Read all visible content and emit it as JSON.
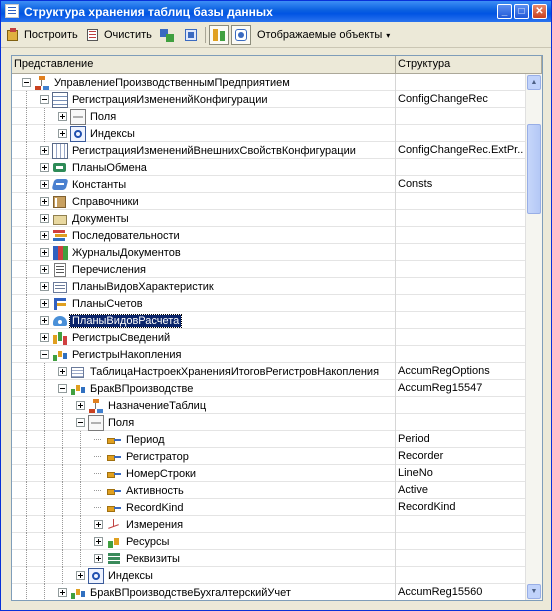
{
  "window": {
    "title": "Структура хранения таблиц базы данных"
  },
  "title_buttons": {
    "minimize": "_",
    "maximize": "□",
    "close": "✕"
  },
  "toolbar": {
    "build_label": "Построить",
    "clear_label": "Очистить",
    "objects_label": "Отображаемые объекты",
    "dropdown_arrow": "▾"
  },
  "columns": {
    "representation": "Представление",
    "structure": "Структура"
  },
  "tree": [
    {
      "label": "УправлениеПроизводственнымПредприятием",
      "structure": "",
      "depth": 0,
      "toggle": "minus",
      "icon": "tree-icon"
    },
    {
      "label": "РегистрацияИзмененийКонфигурации",
      "structure": "ConfigChangeRec",
      "depth": 1,
      "toggle": "minus",
      "icon": "grid-icon"
    },
    {
      "label": "Поля",
      "structure": "",
      "depth": 2,
      "toggle": "plus",
      "icon": "field-icon"
    },
    {
      "label": "Индексы",
      "structure": "",
      "depth": 2,
      "toggle": "plus",
      "icon": "index-icon"
    },
    {
      "label": "РегистрацияИзмененийВнешнихСвойствКонфигурации",
      "structure": "ConfigChangeRec.ExtPr...",
      "depth": 1,
      "toggle": "plus",
      "icon": "ext-grid-icon"
    },
    {
      "label": "ПланыОбмена",
      "structure": "",
      "depth": 1,
      "toggle": "plus",
      "icon": "exchange-plan-icon"
    },
    {
      "label": "Константы",
      "structure": "Consts",
      "depth": 1,
      "toggle": "plus",
      "icon": "constant-icon"
    },
    {
      "label": "Справочники",
      "structure": "",
      "depth": 1,
      "toggle": "plus",
      "icon": "catalog-icon"
    },
    {
      "label": "Документы",
      "structure": "",
      "depth": 1,
      "toggle": "plus",
      "icon": "document-icon"
    },
    {
      "label": "Последовательности",
      "structure": "",
      "depth": 1,
      "toggle": "plus",
      "icon": "sequence-icon"
    },
    {
      "label": "ЖурналыДокументов",
      "structure": "",
      "depth": 1,
      "toggle": "plus",
      "icon": "journal-icon"
    },
    {
      "label": "Перечисления",
      "structure": "",
      "depth": 1,
      "toggle": "plus",
      "icon": "enum-icon"
    },
    {
      "label": "ПланыВидовХарактеристик",
      "structure": "",
      "depth": 1,
      "toggle": "plus",
      "icon": "char-types-icon"
    },
    {
      "label": "ПланыСчетов",
      "structure": "",
      "depth": 1,
      "toggle": "plus",
      "icon": "accounts-icon"
    },
    {
      "label": "ПланыВидовРасчета",
      "structure": "",
      "depth": 1,
      "toggle": "plus",
      "icon": "calc-types-icon",
      "selected": true
    },
    {
      "label": "РегистрыСведений",
      "structure": "",
      "depth": 1,
      "toggle": "plus",
      "icon": "info-register-icon"
    },
    {
      "label": "РегистрыНакопления",
      "structure": "",
      "depth": 1,
      "toggle": "minus",
      "icon": "accum-register-icon"
    },
    {
      "label": "ТаблицаНастроекХраненияИтоговРегистровНакопления",
      "structure": "AccumRegOptions",
      "depth": 2,
      "toggle": "plus",
      "icon": "table-icon"
    },
    {
      "label": "БракВПроизводстве",
      "structure": "AccumReg15547",
      "depth": 2,
      "toggle": "minus",
      "icon": "accum-register-icon"
    },
    {
      "label": "НазначениеТаблиц",
      "structure": "",
      "depth": 3,
      "toggle": "plus",
      "icon": "tree-icon"
    },
    {
      "label": "Поля",
      "structure": "",
      "depth": 3,
      "toggle": "minus",
      "icon": "field-icon"
    },
    {
      "label": "Период",
      "structure": "Period",
      "depth": 4,
      "toggle": "none",
      "icon": "attribute-icon"
    },
    {
      "label": "Регистратор",
      "structure": "Recorder",
      "depth": 4,
      "toggle": "none",
      "icon": "attribute-icon"
    },
    {
      "label": "НомерСтроки",
      "structure": "LineNo",
      "depth": 4,
      "toggle": "none",
      "icon": "attribute-icon"
    },
    {
      "label": "Активность",
      "structure": "Active",
      "depth": 4,
      "toggle": "none",
      "icon": "attribute-icon"
    },
    {
      "label": "RecordKind",
      "structure": "RecordKind",
      "depth": 4,
      "toggle": "none",
      "icon": "attribute-icon"
    },
    {
      "label": "Измерения",
      "structure": "",
      "depth": 4,
      "toggle": "plus",
      "icon": "dimension-icon"
    },
    {
      "label": "Ресурсы",
      "structure": "",
      "depth": 4,
      "toggle": "plus",
      "icon": "resource-icon"
    },
    {
      "label": "Реквизиты",
      "structure": "",
      "depth": 4,
      "toggle": "plus",
      "icon": "requisite-icon"
    },
    {
      "label": "Индексы",
      "structure": "",
      "depth": 3,
      "toggle": "plus",
      "icon": "index-icon"
    },
    {
      "label": "БракВПроизводствеБухгалтерскийУчет",
      "structure": "AccumReg15560",
      "depth": 2,
      "toggle": "plus",
      "icon": "accum-register-icon"
    }
  ]
}
